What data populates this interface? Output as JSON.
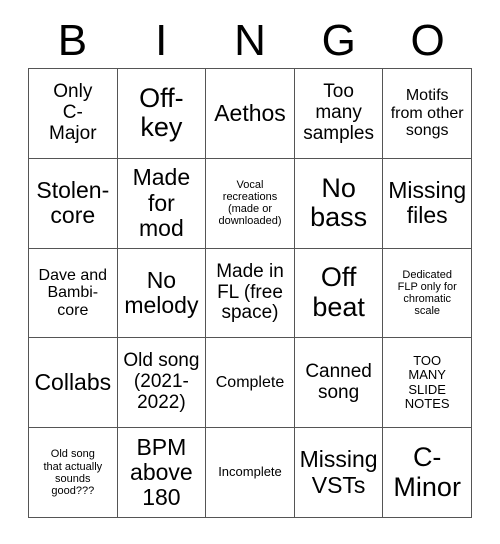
{
  "header": {
    "letters": [
      "B",
      "I",
      "N",
      "G",
      "O"
    ]
  },
  "grid": {
    "rows": 5,
    "columns": 5,
    "cells": [
      {
        "text": "Only\nC-\nMajor",
        "size": "l"
      },
      {
        "text": "Off-\nkey",
        "size": "xxl"
      },
      {
        "text": "Aethos",
        "size": "xl"
      },
      {
        "text": "Too\nmany\nsamples",
        "size": "l"
      },
      {
        "text": "Motifs\nfrom other\nsongs",
        "size": "m"
      },
      {
        "text": "Stolen-\ncore",
        "size": "xl"
      },
      {
        "text": "Made\nfor\nmod",
        "size": "xl"
      },
      {
        "text": "Vocal\nrecreations\n(made or\ndownloaded)",
        "size": "xs"
      },
      {
        "text": "No\nbass",
        "size": "xxl"
      },
      {
        "text": "Missing\nfiles",
        "size": "xl"
      },
      {
        "text": "Dave and\nBambi-\ncore",
        "size": "m"
      },
      {
        "text": "No\nmelody",
        "size": "xl"
      },
      {
        "text": "Made in\nFL (free\nspace)",
        "size": "l"
      },
      {
        "text": "Off\nbeat",
        "size": "xxl"
      },
      {
        "text": "Dedicated\nFLP only for\nchromatic\nscale",
        "size": "xs"
      },
      {
        "text": "Collabs",
        "size": "xl"
      },
      {
        "text": "Old song\n(2021-\n2022)",
        "size": "l"
      },
      {
        "text": "Complete",
        "size": "m"
      },
      {
        "text": "Canned\nsong",
        "size": "l"
      },
      {
        "text": "TOO\nMANY\nSLIDE\nNOTES",
        "size": "s"
      },
      {
        "text": "Old song\nthat actually\nsounds\ngood???",
        "size": "xs"
      },
      {
        "text": "BPM\nabove\n180",
        "size": "xl"
      },
      {
        "text": "Incomplete",
        "size": "s"
      },
      {
        "text": "Missing\nVSTs",
        "size": "xl"
      },
      {
        "text": "C-\nMinor",
        "size": "xxl"
      }
    ]
  },
  "colors": {
    "background": "#ffffff",
    "text": "#000000",
    "gridline": "#555555"
  }
}
